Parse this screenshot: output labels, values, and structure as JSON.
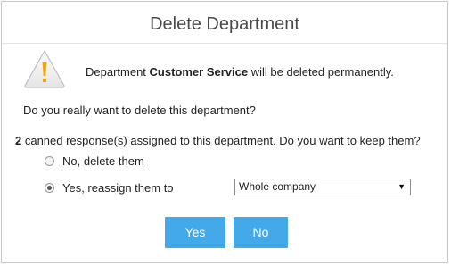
{
  "dialog": {
    "title": "Delete Department",
    "warning": {
      "prefix": "Department ",
      "department_name": "Customer Service",
      "suffix": " will be deleted permanently."
    },
    "question": "Do you really want to delete this department?",
    "canned": {
      "count": "2",
      "text": " canned response(s) assigned to this department. Do you want to keep them?"
    },
    "options": [
      {
        "label": "No, delete them",
        "checked": false
      },
      {
        "label": "Yes, reassign them to",
        "checked": true
      }
    ],
    "reassign_select": {
      "selected": "Whole company"
    },
    "buttons": {
      "yes": "Yes",
      "no": "No"
    },
    "colors": {
      "button": "#43a9e8",
      "warning_icon": "#f0a30a"
    },
    "icons": {
      "warning": "warning-triangle-icon",
      "dropdown": "dropdown-arrow-icon"
    }
  }
}
